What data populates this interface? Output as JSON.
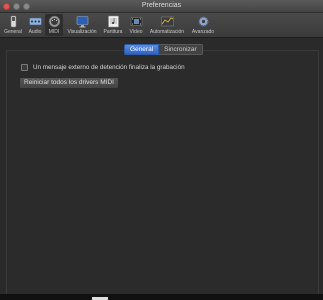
{
  "window": {
    "title": "Preferencias"
  },
  "toolbar": {
    "items": [
      {
        "label": "General",
        "icon": "general-switch-icon"
      },
      {
        "label": "Audio",
        "icon": "audio-interface-icon"
      },
      {
        "label": "MIDI",
        "icon": "midi-port-icon"
      },
      {
        "label": "Visualización",
        "icon": "display-monitor-icon"
      },
      {
        "label": "Partitura",
        "icon": "score-icon"
      },
      {
        "label": "Vídeo",
        "icon": "film-icon"
      },
      {
        "label": "Automatización",
        "icon": "automation-icon"
      },
      {
        "label": "Avanzado",
        "icon": "gear-icon"
      }
    ],
    "selected": "MIDI"
  },
  "tabs": [
    {
      "label": "General",
      "active": true
    },
    {
      "label": "Sincronizar",
      "active": false
    }
  ],
  "settings": {
    "checkbox_label": "Un mensaje externo de detención finaliza la grabación",
    "checkbox_checked": false,
    "reset_button": "Reiniciar todos los drivers MIDI"
  }
}
